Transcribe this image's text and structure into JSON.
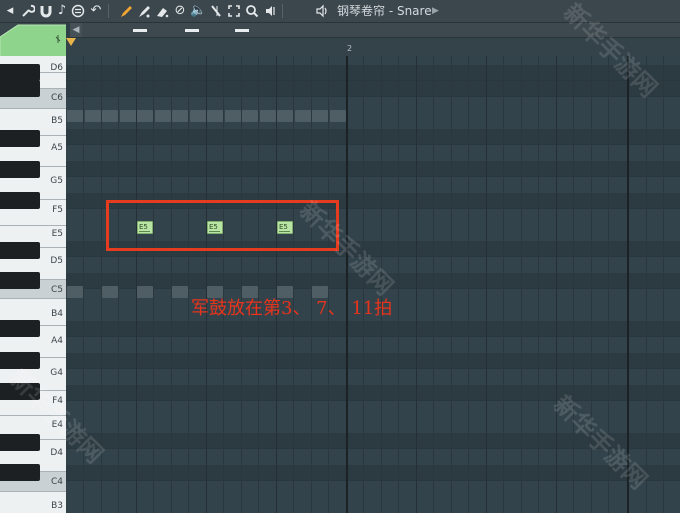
{
  "toolbar": {
    "icons": [
      "menu-arrow-icon",
      "wrench-icon",
      "magnet-icon",
      "note-icon",
      "stamp-icon",
      "undo-icon",
      "pencil-icon",
      "brush-icon",
      "eraser-icon",
      "mute-icon",
      "speaker-icon",
      "slice-icon",
      "select-icon",
      "zoom-icon",
      "playback-icon"
    ],
    "title": "钢琴卷帘 - Snare"
  },
  "timeline": {
    "bar_label": "2"
  },
  "keyboard": {
    "labels": [
      "D6",
      "C6",
      "B5",
      "A5",
      "G5",
      "F5",
      "E5",
      "D5",
      "C5",
      "B4",
      "A4",
      "G4",
      "F4",
      "E4",
      "D4",
      "C4",
      "B3"
    ]
  },
  "notes": [
    {
      "pitch": "E5",
      "step": 3
    },
    {
      "pitch": "E5",
      "step": 7
    },
    {
      "pitch": "E5",
      "step": 11
    }
  ],
  "annotation": {
    "text": "军鼓放在第3、 7、 11拍"
  },
  "watermark": {
    "text": "新华手游网"
  },
  "colors": {
    "toolbar_accent": "#f2a531",
    "note_fill": "#b8e4a4",
    "annotation_red": "#e53b1f"
  }
}
